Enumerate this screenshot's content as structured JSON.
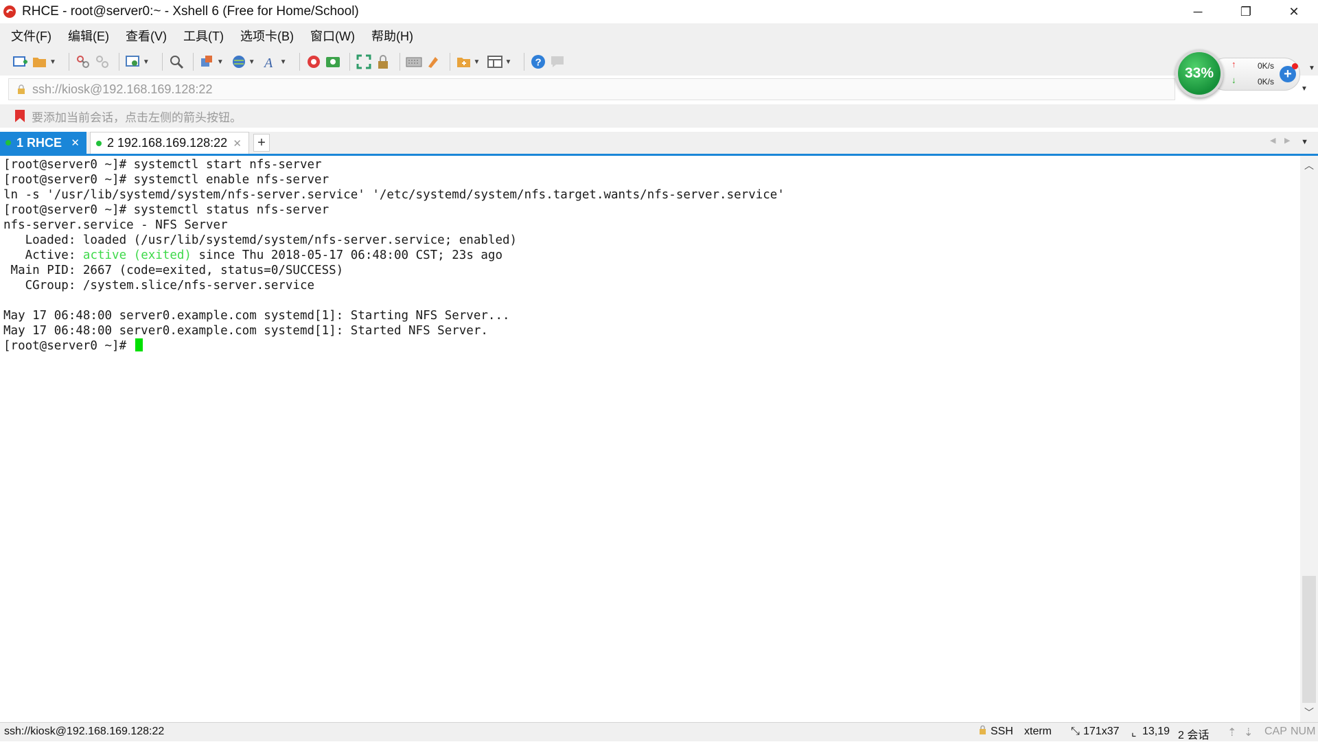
{
  "window": {
    "title": "RHCE - root@server0:~ - Xshell 6 (Free for Home/School)",
    "minimize": "─",
    "restore": "❐",
    "close": "✕"
  },
  "menu": [
    {
      "label": "文件(F)"
    },
    {
      "label": "编辑(E)"
    },
    {
      "label": "查看(V)"
    },
    {
      "label": "工具(T)"
    },
    {
      "label": "选项卡(B)"
    },
    {
      "label": "窗口(W)"
    },
    {
      "label": "帮助(H)"
    }
  ],
  "address": {
    "value": "ssh://kiosk@192.168.169.128:22"
  },
  "hint": {
    "text": "要添加当前会话，点击左侧的箭头按钮。"
  },
  "speed_widget": {
    "percent": "33%",
    "upload": "0K/s",
    "download": "0K/s",
    "plus": "+"
  },
  "tabs": [
    {
      "label": "1 RHCE",
      "active": true
    },
    {
      "label": "2 192.168.169.128:22",
      "active": false
    }
  ],
  "tab_add": "+",
  "terminal": {
    "lines": [
      "[root@server0 ~]# systemctl start nfs-server",
      "[root@server0 ~]# systemctl enable nfs-server",
      "ln -s '/usr/lib/systemd/system/nfs-server.service' '/etc/systemd/system/nfs.target.wants/nfs-server.service'",
      "[root@server0 ~]# systemctl status nfs-server",
      "nfs-server.service - NFS Server",
      "   Loaded: loaded (/usr/lib/systemd/system/nfs-server.service; enabled)",
      "",
      " Main PID: 2667 (code=exited, status=0/SUCCESS)",
      "   CGroup: /system.slice/nfs-server.service",
      "",
      "May 17 06:48:00 server0.example.com systemd[1]: Starting NFS Server...",
      "May 17 06:48:00 server0.example.com systemd[1]: Started NFS Server.",
      "[root@server0 ~]# "
    ],
    "active_prefix": "   Active: ",
    "active_status": "active (exited)",
    "active_suffix": " since Thu 2018-05-17 06:48:00 CST; 23s ago"
  },
  "statusbar": {
    "connection": "ssh://kiosk@192.168.169.128:22",
    "protocol": "SSH",
    "terminal_type": "xterm",
    "size": "171x37",
    "cursor_pos": "13,19",
    "sessions": "2 会话",
    "caps": "CAP",
    "num": "NUM"
  },
  "colors": {
    "accent": "#1a86d8",
    "terminal_green": "#3ed94a",
    "cursor": "#00e000",
    "speed_green": "#16913a"
  },
  "icons": [
    "app-icon",
    "new-session-icon",
    "open-folder-icon",
    "connect-icon",
    "disconnect-icon",
    "properties-icon",
    "find-icon",
    "transfer-icon",
    "globe-icon",
    "font-icon",
    "xftp-icon",
    "xmanager-icon",
    "fullscreen-icon",
    "lock-icon",
    "keyboard-icon",
    "highlight-icon",
    "add-folder-icon",
    "layout-icon",
    "help-icon",
    "chat-icon",
    "bookmark-flag-icon",
    "lock-small-icon"
  ]
}
